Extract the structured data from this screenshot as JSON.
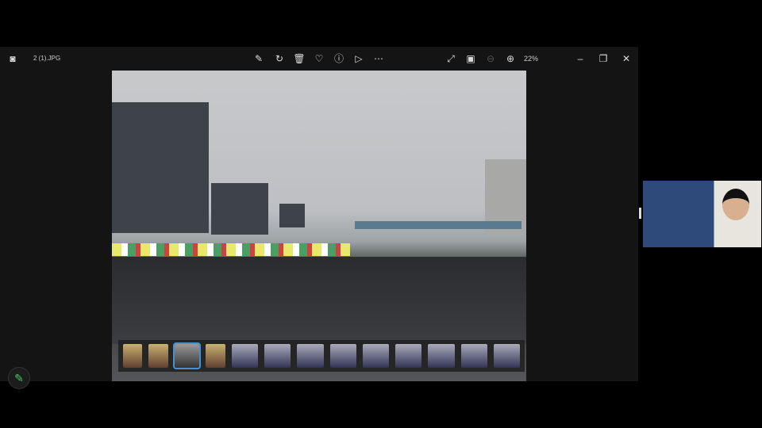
{
  "viewer": {
    "title": "2 (1).JPG",
    "zoom": "22%",
    "toolbar": [
      {
        "name": "edit-icon",
        "glyph": "✎"
      },
      {
        "name": "rotate-icon",
        "glyph": "↻"
      },
      {
        "name": "delete-icon",
        "glyph": "🗑"
      },
      {
        "name": "favorite-icon",
        "glyph": "♡"
      },
      {
        "name": "info-icon",
        "glyph": "ⓘ"
      },
      {
        "name": "slideshow-icon",
        "glyph": "▷"
      },
      {
        "name": "more-icon",
        "glyph": "⋯"
      }
    ],
    "thumbnail_count": 13,
    "selected_thumbnail": 3
  },
  "window_controls": {
    "minimize": "–",
    "maximize": "❐",
    "close": "✕"
  },
  "accent": "#4a90d0"
}
